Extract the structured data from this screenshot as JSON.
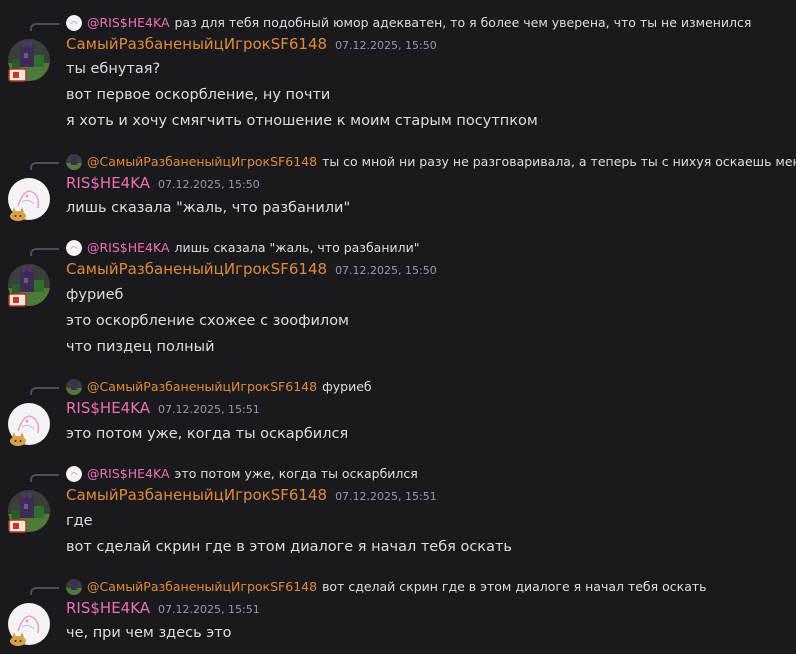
{
  "colors": {
    "background": "#1a1a1e",
    "text": "#dbdee1",
    "timestamp": "#949ba4",
    "user_orange": "#e08a3a",
    "user_pink": "#ef6fb3",
    "reply_spine": "#4e5058"
  },
  "users": {
    "sf": {
      "name": "СамыйРазбаненыйцИгрокSF6148",
      "mention": "@СамыйРазбаненыйцИгрокSF6148",
      "color": "#e08a3a",
      "avatar_icon": "pixel-castle-avatar"
    },
    "ris": {
      "name": "RIS$HE4KA",
      "mention": "@RIS$HE4KA",
      "color": "#ef6fb3",
      "avatar_icon": "white-sketch-avatar"
    }
  },
  "messages": [
    {
      "reply": {
        "author": "@RIS$HE4KA",
        "text": "раз для тебя подобный юмор адекватен, то я более чем уверена, что ты не изменился"
      },
      "author": "СамыйРазбаненыйцИгрокSF6148",
      "timestamp": "07.12.2025, 15:50",
      "lines": [
        "ты ебнутая?",
        "вот первое оскорбление, ну почти",
        "я хоть и хочу смягчить отношение к моим старым посутпком"
      ]
    },
    {
      "reply": {
        "author": "@СамыйРазбаненыйцИгрокSF6148",
        "text": "ты со мной ни разу не разговаривала, а теперь ты с нихуя оскаешь меня"
      },
      "author": "RIS$HE4KA",
      "timestamp": "07.12.2025, 15:50",
      "lines": [
        "лишь сказала \"жаль, что разбанили\""
      ]
    },
    {
      "reply": {
        "author": "@RIS$HE4KA",
        "text": "лишь сказала \"жаль, что разбанили\""
      },
      "author": "СамыйРазбаненыйцИгрокSF6148",
      "timestamp": "07.12.2025, 15:50",
      "lines": [
        "фуриеб",
        "это оскорбление схожее с зоофилом",
        "что пиздец полный"
      ]
    },
    {
      "reply": {
        "author": "@СамыйРазбаненыйцИгрокSF6148",
        "text": "фуриеб"
      },
      "author": "RIS$HE4KA",
      "timestamp": "07.12.2025, 15:51",
      "lines": [
        "это потом уже, когда ты оскарбился"
      ]
    },
    {
      "reply": {
        "author": "@RIS$HE4KA",
        "text": "это потом уже, когда ты оскарбился"
      },
      "author": "СамыйРазбаненыйцИгрокSF6148",
      "timestamp": "07.12.2025, 15:51",
      "lines": [
        "где",
        "вот сделай скрин где в этом диалоге я начал тебя оскать"
      ]
    },
    {
      "reply": {
        "author": "@СамыйРазбаненыйцИгрокSF6148",
        "text": "вот сделай скрин где в этом диалоге я начал тебя оскать"
      },
      "author": "RIS$HE4KA",
      "timestamp": "07.12.2025, 15:51",
      "lines": [
        "че, при чем здесь это"
      ]
    }
  ]
}
